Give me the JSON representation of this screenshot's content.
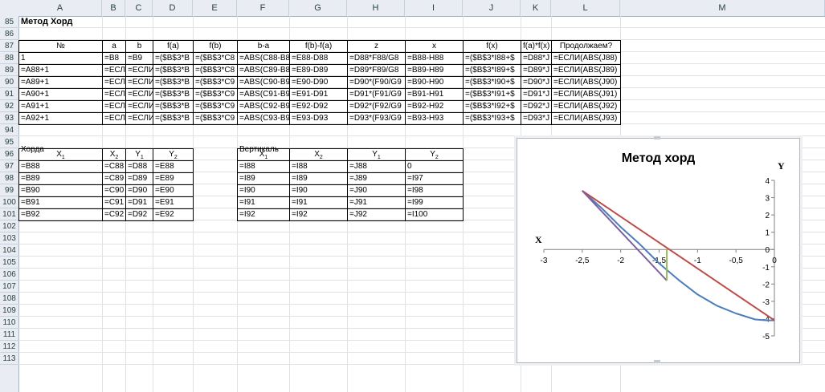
{
  "columns": [
    "A",
    "B",
    "C",
    "D",
    "E",
    "F",
    "G",
    "H",
    "I",
    "J",
    "K",
    "L",
    "M"
  ],
  "rows": [
    "85",
    "86",
    "87",
    "88",
    "89",
    "90",
    "91",
    "92",
    "93",
    "94",
    "95",
    "96",
    "97",
    "98",
    "99",
    "100",
    "101",
    "102",
    "103",
    "104",
    "105",
    "106",
    "107",
    "108",
    "109",
    "110",
    "111",
    "112",
    "113"
  ],
  "title": "Метод Хорд",
  "main_headers": [
    "№",
    "a",
    "b",
    "f(a)",
    "f(b)",
    "b-a",
    "f(b)-f(a)",
    "z",
    "x",
    "f(x)",
    "f(a)*f(x)",
    "Продолжаем?"
  ],
  "main_rows": [
    [
      "1",
      "=B8",
      "=B9",
      "=($B$3*B",
      "=($B$3*C8",
      "=ABS(C88-B8",
      "=E88-D88",
      "=D88*F88/G8",
      "=B88-H88",
      "=($B$3*I88+$",
      "=D88*J",
      "=ЕСЛИ(ABS(J88)"
    ],
    [
      "=A88+1",
      "=ЕСЛИ",
      "=ЕСЛИ",
      "=($B$3*B",
      "=($B$3*C8",
      "=ABS(C89-B8",
      "=E89-D89",
      "=D89*F89/G8",
      "=B89-H89",
      "=($B$3*I89+$",
      "=D89*J",
      "=ЕСЛИ(ABS(J89)"
    ],
    [
      "=A89+1",
      "=ЕСЛИ",
      "=ЕСЛИ",
      "=($B$3*B",
      "=($B$3*C9",
      "=ABS(C90-B9",
      "=E90-D90",
      "=D90*(F90/G9",
      "=B90-H90",
      "=($B$3*I90+$",
      "=D90*J",
      "=ЕСЛИ(ABS(J90)"
    ],
    [
      "=A90+1",
      "=ЕСЛИ",
      "=ЕСЛИ",
      "=($B$3*B",
      "=($B$3*C9",
      "=ABS(C91-B9",
      "=E91-D91",
      "=D91*(F91/G9",
      "=B91-H91",
      "=($B$3*I91+$",
      "=D91*J",
      "=ЕСЛИ(ABS(J91)"
    ],
    [
      "=A91+1",
      "=ЕСЛИ",
      "=ЕСЛИ",
      "=($B$3*B",
      "=($B$3*C9",
      "=ABS(C92-B9",
      "=E92-D92",
      "=D92*(F92/G9",
      "=B92-H92",
      "=($B$3*I92+$",
      "=D92*J",
      "=ЕСЛИ(ABS(J92)"
    ],
    [
      "=A92+1",
      "=ЕСЛ",
      "=ЕСЛИ",
      "=($B$3*B",
      "=($B$3*C9",
      "=ABS(C93-B9",
      "=E93-D93",
      "=D93*(F93/G9",
      "=B93-H93",
      "=($B$3*I93+$",
      "=D93*J",
      "=ЕСЛИ(ABS(J93)"
    ]
  ],
  "chord": {
    "label": "Хорда",
    "headers": [
      {
        "b": "X",
        "s": "1"
      },
      {
        "b": "X",
        "s": "2"
      },
      {
        "b": "Y",
        "s": "1"
      },
      {
        "b": "Y",
        "s": "2"
      }
    ],
    "rows": [
      [
        "=B88",
        "=C88",
        "=D88",
        "=E88"
      ],
      [
        "=B89",
        "=C89",
        "=D89",
        "=E89"
      ],
      [
        "=B90",
        "=C90",
        "=D90",
        "=E90"
      ],
      [
        "=B91",
        "=C91",
        "=D91",
        "=E91"
      ],
      [
        "=B92",
        "=C92",
        "=D92",
        "=E92"
      ]
    ]
  },
  "vertical": {
    "label": "Вертикаль",
    "headers": [
      {
        "b": "X",
        "s": "1"
      },
      {
        "b": "X",
        "s": "2"
      },
      {
        "b": "Y",
        "s": "1"
      },
      {
        "b": "Y",
        "s": "2"
      }
    ],
    "rows": [
      [
        "=I88",
        "=I88",
        "=J88",
        "0"
      ],
      [
        "=I89",
        "=I89",
        "=J89",
        "=I97"
      ],
      [
        "=I90",
        "=I90",
        "=J90",
        "=I98"
      ],
      [
        "=I91",
        "=I91",
        "=J91",
        "=I99"
      ],
      [
        "=I92",
        "=I92",
        "=J92",
        "=I100"
      ]
    ]
  },
  "chart_data": {
    "type": "line",
    "title": "Метод хорд",
    "xlabel": "X",
    "ylabel": "Y",
    "xlim": [
      -3,
      0
    ],
    "ylim": [
      -5,
      4
    ],
    "x_ticks": [
      "-3",
      "-2,5",
      "-2",
      "-1,5",
      "-1",
      "-0,5",
      "0"
    ],
    "y_ticks": [
      "4",
      "3",
      "2",
      "1",
      "0",
      "-1",
      "-2",
      "-3",
      "-4",
      "-5"
    ],
    "series": [
      {
        "color": "#4a7ebb",
        "x": [
          -2.5,
          -2.25,
          -2.0,
          -1.75,
          -1.5,
          -1.25,
          -1.0,
          -0.75,
          -0.5,
          -0.25,
          -0.1,
          0
        ],
        "y": [
          3.4,
          2.4,
          1.3,
          0.3,
          -0.8,
          -1.75,
          -2.6,
          -3.25,
          -3.7,
          -4.05,
          -4.1,
          -4.1
        ]
      },
      {
        "color": "#be4b48",
        "x": [
          -2.5,
          0
        ],
        "y": [
          3.4,
          -4.1
        ]
      },
      {
        "color": "#7d60a0",
        "x": [
          -2.5,
          -1.4
        ],
        "y": [
          3.4,
          -1.8
        ]
      },
      {
        "color": "#98b954",
        "x": [
          -1.4,
          -1.4
        ],
        "y": [
          0,
          -1.8
        ]
      }
    ]
  }
}
